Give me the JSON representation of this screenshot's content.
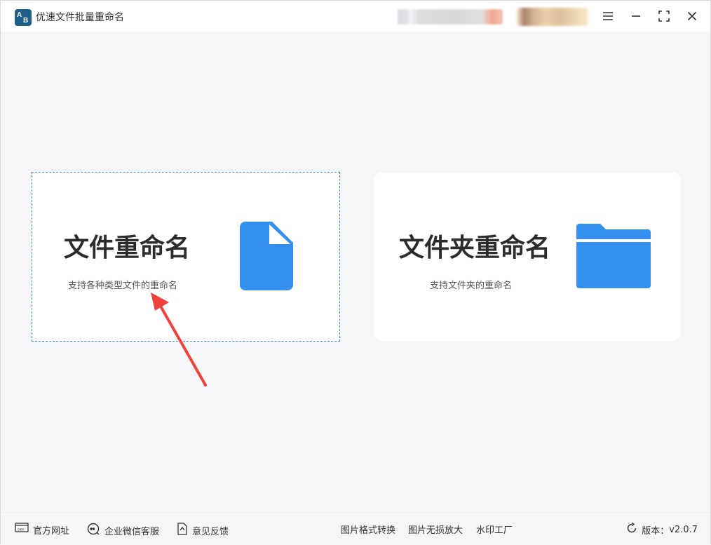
{
  "app": {
    "title": "优速文件批量重命名"
  },
  "cards": [
    {
      "title": "文件重命名",
      "subtitle": "支持各种类型文件的重命名",
      "icon": "file-icon"
    },
    {
      "title": "文件夹重命名",
      "subtitle": "支持文件夹的重命名",
      "icon": "folder-icon"
    }
  ],
  "footer": {
    "official_site": "官方网址",
    "wechat_service": "企业微信客服",
    "feedback": "意见反馈",
    "image_convert": "图片格式转换",
    "image_upscale": "图片无损放大",
    "watermark": "水印工厂",
    "version_label": "版本：",
    "version_value": "v2.0.7"
  },
  "colors": {
    "accent": "#3591f0",
    "arrow": "#f0413a",
    "selected_border": "#3c8fd8"
  }
}
